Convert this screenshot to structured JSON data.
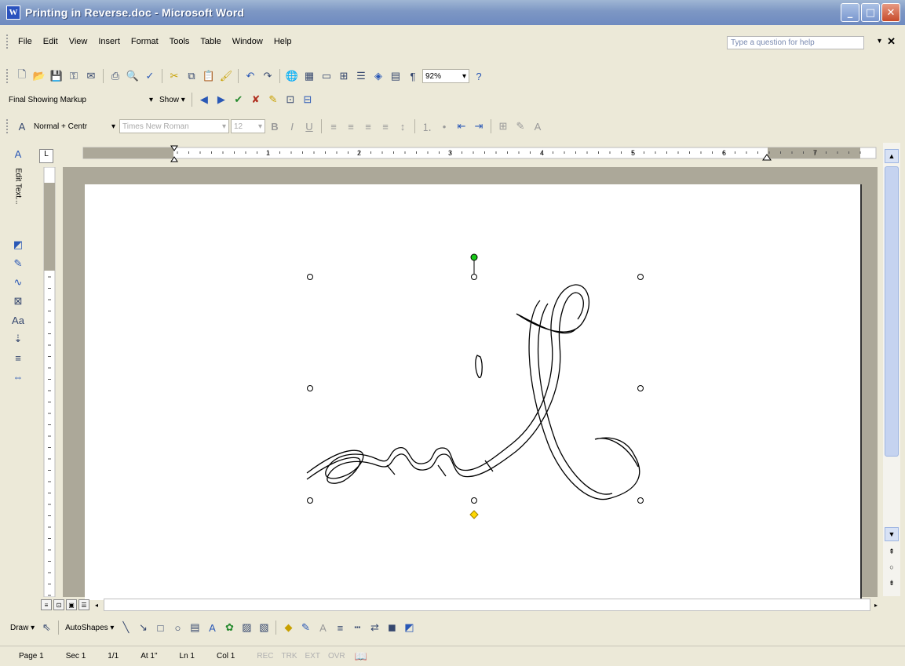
{
  "window": {
    "title": "Printing in Reverse.doc - Microsoft Word",
    "minimize": "_",
    "maximize": "□",
    "close": "✕"
  },
  "menu": [
    "File",
    "Edit",
    "View",
    "Insert",
    "Format",
    "Tools",
    "Table",
    "Window",
    "Help"
  ],
  "help": {
    "placeholder": "Type a question for help",
    "arrow": "▾",
    "close": "✕"
  },
  "standard_toolbar": {
    "zoom": "92%"
  },
  "reviewing_toolbar": {
    "display_for_review": "Final Showing Markup",
    "show_label": "Show ▾"
  },
  "formatting_toolbar": {
    "style": "Normal + Centr",
    "font": "Times New Roman",
    "size": "12"
  },
  "ruler": {
    "numbers": [
      "1",
      "2",
      "3",
      "4",
      "5",
      "6",
      "7"
    ],
    "corner": "L"
  },
  "left_tools": {
    "edit_text_label": "Edit Text..."
  },
  "drawing_toolbar": {
    "draw_label": "Draw ▾",
    "autoshapes_label": "AutoShapes ▾"
  },
  "status": {
    "page": "Page 1",
    "section": "Sec 1",
    "pages": "1/1",
    "at": "At 1\"",
    "line": "Ln 1",
    "col": "Col 1",
    "rec": "REC",
    "trk": "TRK",
    "ext": "EXT",
    "ovr": "OVR"
  },
  "colors": {
    "titlebar": "#7d97c4",
    "toolbar": "#ece9d8",
    "gray_area": "#aca899",
    "rotation_handle": "#18c818",
    "adjust_handle": "#ffd800"
  },
  "icons": [
    "word-icon",
    "new-icon",
    "open-icon",
    "save-icon",
    "print-icon",
    "zoom-icon",
    "wordart-icon",
    "help-icon"
  ]
}
